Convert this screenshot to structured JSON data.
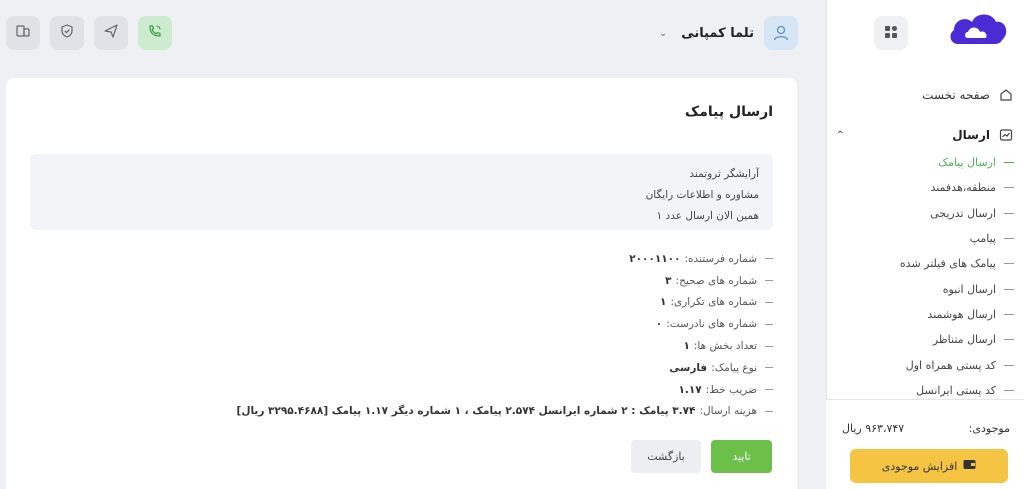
{
  "user": {
    "name": "تلما کمپانی"
  },
  "sidebar": {
    "home_label": "صفحه نخست",
    "send_label": "ارسال",
    "items": [
      "ارسال پیامک",
      "منطقه،هدفمند",
      "ارسال تدریجی",
      "پیامپ",
      "پیامک های فیلتر شده",
      "ارسال انبوه",
      "ارسال هوشمند",
      "ارسال متناظر",
      "کد پستی همراه اول",
      "کد پستی ایرانسل"
    ],
    "active_index": 0,
    "balance_label": "موجودی:",
    "balance_value": "۹۶۳،۷۴۷ ریال",
    "topup_label": "افزایش موجودی"
  },
  "card": {
    "title": "ارسال پیامک",
    "message_lines": [
      "آرایشگر ثروتمند",
      "مشاوره و اطلاعات رایگان",
      "همین الان ارسال عدد ۱"
    ],
    "details": [
      {
        "label": "شماره فرستنده:",
        "value": "۲۰۰۰۱۱۰۰"
      },
      {
        "label": "شماره های صحیح:",
        "value": "۳"
      },
      {
        "label": "شماره های تکراری:",
        "value": "۱"
      },
      {
        "label": "شماره های نادرست:",
        "value": "۰"
      },
      {
        "label": "تعداد بخش ها:",
        "value": "۱"
      },
      {
        "label": "نوع پیامک:",
        "value": "فارسی"
      },
      {
        "label": "ضریب خط:",
        "value": "۱.۱۷"
      },
      {
        "label": "هزینه ارسال:",
        "value": "۳.۷۴ پیامک : ۲ شماره ایرانسل ۲.۵۷۴ پیامک ، ۱ شماره دیگر ۱.۱۷ پیامک [۳۲۹۵.۴۶۸۸ ریال]"
      }
    ],
    "confirm_label": "تایید",
    "back_label": "بازگشت"
  },
  "colors": {
    "accent_green": "#6cc04a",
    "brand_purple": "#4a2bd6",
    "topup_yellow": "#f5c443"
  },
  "icons": [
    "phone-icon",
    "send-icon",
    "shield-icon",
    "document-icon",
    "user-icon",
    "grid-icon",
    "home-icon",
    "chart-icon",
    "wallet-icon",
    "cloud-logo"
  ]
}
